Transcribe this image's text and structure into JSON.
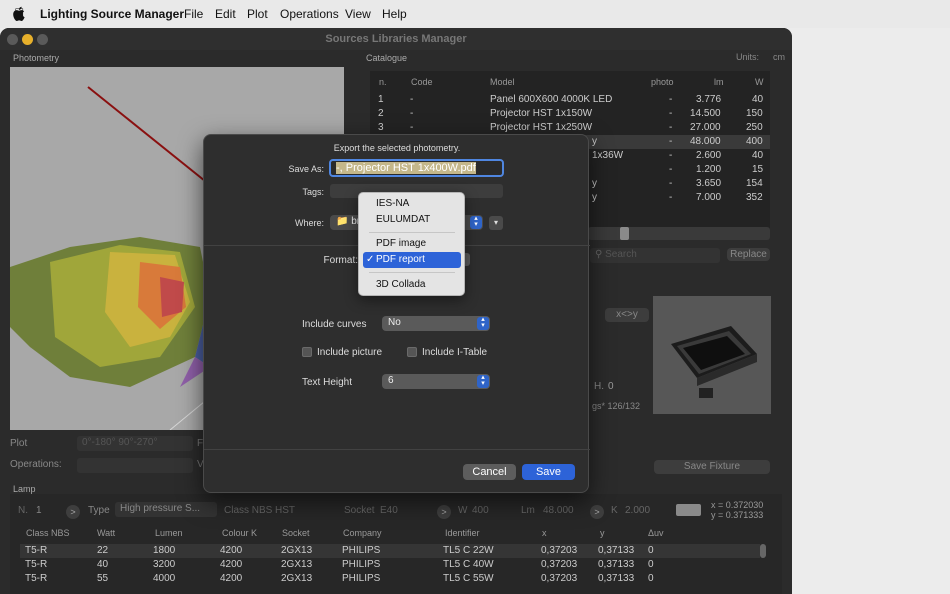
{
  "menubar": {
    "app_name": "Lighting Source Manager",
    "items": [
      "File",
      "Edit",
      "Plot",
      "Operations",
      "View",
      "Help"
    ]
  },
  "window": {
    "title": "Sources Libraries Manager"
  },
  "photometry": {
    "label": "Photometry",
    "plot_label": "Plot",
    "plot_value": "0°-180° 90°-270°",
    "operations_label": "Operations:"
  },
  "catalogue": {
    "label": "Catalogue",
    "units_label": "Units:",
    "units_value": "cm",
    "columns": [
      "n.",
      "Code",
      "Model",
      "photo",
      "lm",
      "W"
    ],
    "rows": [
      {
        "n": "1",
        "code": "-",
        "model": "Panel 600X600 4000K LED",
        "photo": "-",
        "lm": "3.776",
        "w": "40"
      },
      {
        "n": "2",
        "code": "-",
        "model": "Projector HST 1x150W",
        "photo": "-",
        "lm": "14.500",
        "w": "150"
      },
      {
        "n": "3",
        "code": "-",
        "model": "Projector HST 1x250W",
        "photo": "-",
        "lm": "27.000",
        "w": "250"
      },
      {
        "n": "",
        "code": "",
        "model": "y",
        "photo": "-",
        "lm": "48.000",
        "w": "400"
      },
      {
        "n": "",
        "code": "",
        "model": "1x36W",
        "photo": "-",
        "lm": "2.600",
        "w": "40"
      },
      {
        "n": "",
        "code": "",
        "model": "",
        "photo": "-",
        "lm": "1.200",
        "w": "15"
      },
      {
        "n": "",
        "code": "",
        "model": "y",
        "photo": "-",
        "lm": "3.650",
        "w": "154"
      },
      {
        "n": "",
        "code": "",
        "model": "y",
        "photo": "-",
        "lm": "7.000",
        "w": "352"
      }
    ],
    "search_placeholder": "Search",
    "replace_label": "Replace",
    "swap_label": "x<>y",
    "h_label": "H.",
    "h_value": "0",
    "images_text": "gs* 126/132",
    "save_fixture_label": "Save Fixture"
  },
  "lamp": {
    "label": "Lamp",
    "n_label": "N.",
    "n_value": "1",
    "type_label": "Type",
    "type_value": "High pressure S...",
    "class_label": "Class NBS",
    "class_value": "HST",
    "socket_label": "Socket",
    "socket_value": "E40",
    "w_label": "W",
    "w_value": "400",
    "lm_label": "Lm",
    "lm_value": "48.000",
    "k_label": "K",
    "k_value": "2.000",
    "x_text": "x = 0.372030",
    "y_text": "y = 0.371333",
    "columns": [
      "Class NBS",
      "Watt",
      "Lumen",
      "Colour K",
      "Socket",
      "Company",
      "Identifier",
      "x",
      "y",
      "Δuv"
    ],
    "rows": [
      [
        "T5-R",
        "22",
        "1800",
        "4200",
        "2GX13",
        "PHILIPS",
        "TL5 C 22W",
        "0,37203",
        "0,37133",
        "0"
      ],
      [
        "T5-R",
        "40",
        "3200",
        "4200",
        "2GX13",
        "PHILIPS",
        "TL5 C 40W",
        "0,37203",
        "0,37133",
        "0"
      ],
      [
        "T5-R",
        "55",
        "4000",
        "4200",
        "2GX13",
        "PHILIPS",
        "TL5 C 55W",
        "0,37203",
        "0,37133",
        "0"
      ]
    ]
  },
  "export_sheet": {
    "message": "Export the selected photometry.",
    "save_as_label": "Save As:",
    "save_as_value": "-, Projector HST 1x400W.pdf",
    "tags_label": "Tags:",
    "where_label": "Where:",
    "where_value": "br",
    "format_label": "Format:",
    "format_options": [
      "IES-NA",
      "EULUMDAT",
      "PDF image",
      "PDF report",
      "3D Collada"
    ],
    "format_selected": "PDF report",
    "check_mark": "✓",
    "include_curves_label": "Include curves",
    "include_curves_value": "No",
    "include_picture_label": "Include picture",
    "include_itable_label": "Include I-Table",
    "text_height_label": "Text Height",
    "text_height_value": "6",
    "cancel_label": "Cancel",
    "save_label": "Save"
  },
  "colors": {
    "accent": "#2d63d8",
    "window_bg": "#2b2b2b",
    "sheet_bg": "#2e2e2e"
  }
}
